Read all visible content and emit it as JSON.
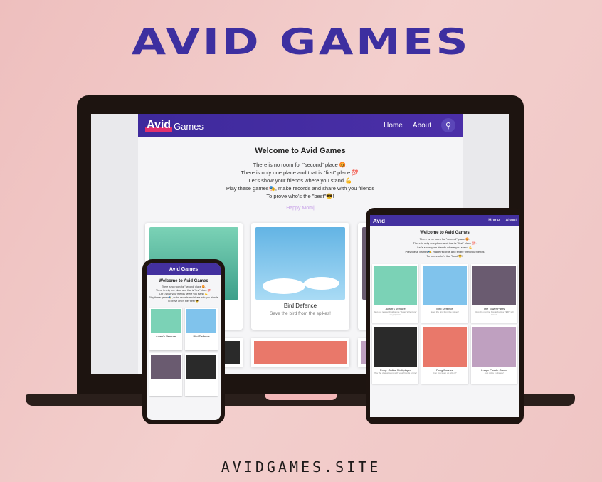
{
  "banner": {
    "title": "AVID GAMES",
    "site_url": "AVIDGAMES.SITE"
  },
  "website": {
    "logo_avid": "Avid",
    "logo_games": "Games",
    "nav": [
      "Home",
      "About"
    ],
    "welcome_title": "Welcome to Avid Games",
    "welcome_lines": [
      "There is no room for \"second\" place 😡.",
      "There is only one place and that is \"first\" place 💯.",
      "Let's show your friends where you stand 💪",
      "Play these games🎭, make records and share with you friends",
      "To prove who's the \"best\"😎!"
    ],
    "search_value": "Happy Mom|",
    "cards": [
      {
        "title": "Adam's Venture",
        "desc": "Get our new android game \"Adam's Venture\" on playstore"
      },
      {
        "title": "Bird Defence",
        "desc": "Save the bird from the spikes!"
      },
      {
        "title": "The Tower Parity",
        "desc": "Drop the moving box to build a VERY tall tower!"
      },
      {
        "title": "Pong: Online Multiplayer",
        "desc": "Play the classic pong with your friends online!"
      },
      {
        "title": "Pong Bounce",
        "desc": "Can you keep up with it?"
      },
      {
        "title": "Image Puzzle Game",
        "desc": "Just solve it already!"
      }
    ]
  },
  "colors": {
    "background": "#f0c9c8",
    "brand": "#3d2fa0",
    "accent": "#e2306c"
  }
}
